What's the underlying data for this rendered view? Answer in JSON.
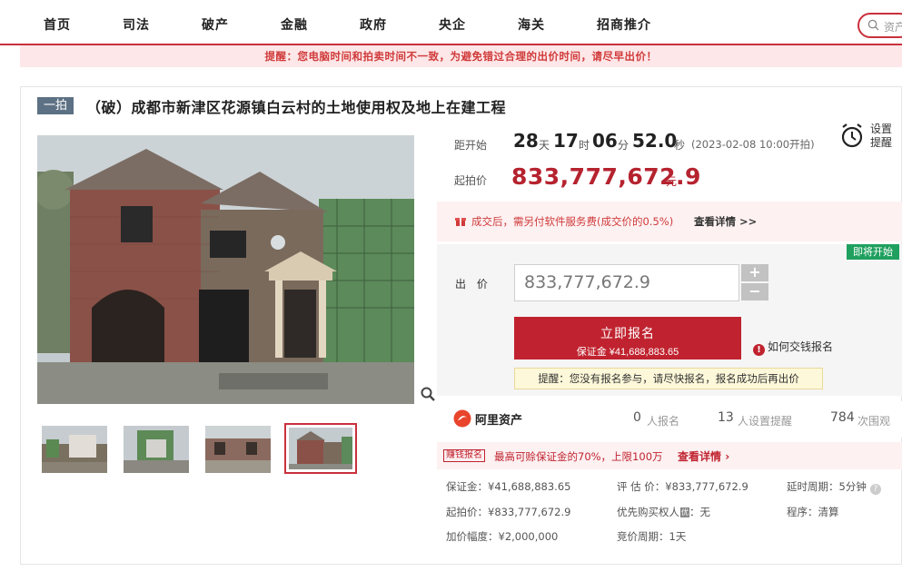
{
  "nav": {
    "items": [
      "首页",
      "司法",
      "破产",
      "金融",
      "政府",
      "央企",
      "海关",
      "招商推介"
    ],
    "search_placeholder": "资产"
  },
  "notice": "提醒：您电脑时间和拍卖时间不一致，为避免错过合理的出价时间，请尽早出价！",
  "item": {
    "badge": "一拍",
    "title": "（破）成都市新津区花源镇白云村的土地使用权及地上在建工程"
  },
  "countdown": {
    "label": "距开始",
    "days": "28",
    "days_unit": "天",
    "hours": "17",
    "hours_unit": "时",
    "minutes": "06",
    "minutes_unit": "分",
    "seconds": "52.0",
    "seconds_unit": "秒",
    "start_note": "(2023-02-08 10:00开拍)"
  },
  "reminder": {
    "line1": "设置",
    "line2": "提醒"
  },
  "start_price": {
    "label": "起拍价",
    "value": "833,777,672.9",
    "unit": "元"
  },
  "fee": {
    "text": "成交后，需另付软件服务费(成交价的0.5%)",
    "link": "查看详情 >>"
  },
  "bid": {
    "status_badge": "即将开始",
    "label": "出 价",
    "input_value": "833,777,672.9",
    "plus": "+",
    "minus": "−",
    "signup_label": "立即报名",
    "deposit_label": "保证金 ¥41,688,883.65",
    "how_pay": "如何交钱报名",
    "remind": "提醒：您没有报名参与，请尽快报名，报名成功后再出价"
  },
  "stats": {
    "brand": "阿里资产",
    "signups": "0",
    "signups_label": "人报名",
    "reminders": "13",
    "reminders_label": "人设置提醒",
    "views": "784",
    "views_label": "次围观"
  },
  "promo": {
    "tag": "赚钱报名",
    "text": "最高可赊保证金的70%，上限100万",
    "link": "查看详情"
  },
  "info": {
    "deposit": "保证金：¥41,688,883.65",
    "appraisal": "评 估 价：¥833,777,672.9",
    "delay": "延时周期：5分钟",
    "start_price": "起拍价：¥833,777,672.9",
    "priority": "优先购买权人",
    "priority_tag": "优",
    "priority_value": "：无",
    "procedure": "程序：清算",
    "increment": "加价幅度：¥2,000,000",
    "cycle": "竞价周期：1天"
  },
  "colors": {
    "accent": "#c0232f",
    "price": "#b5232f",
    "nav_border": "#c9303c",
    "status_green": "#1fa05e"
  },
  "icons": [
    "search-icon",
    "zoom-icon",
    "alarm-clock-icon",
    "gift-icon",
    "info-icon",
    "alibaba-logo",
    "help-icon"
  ]
}
